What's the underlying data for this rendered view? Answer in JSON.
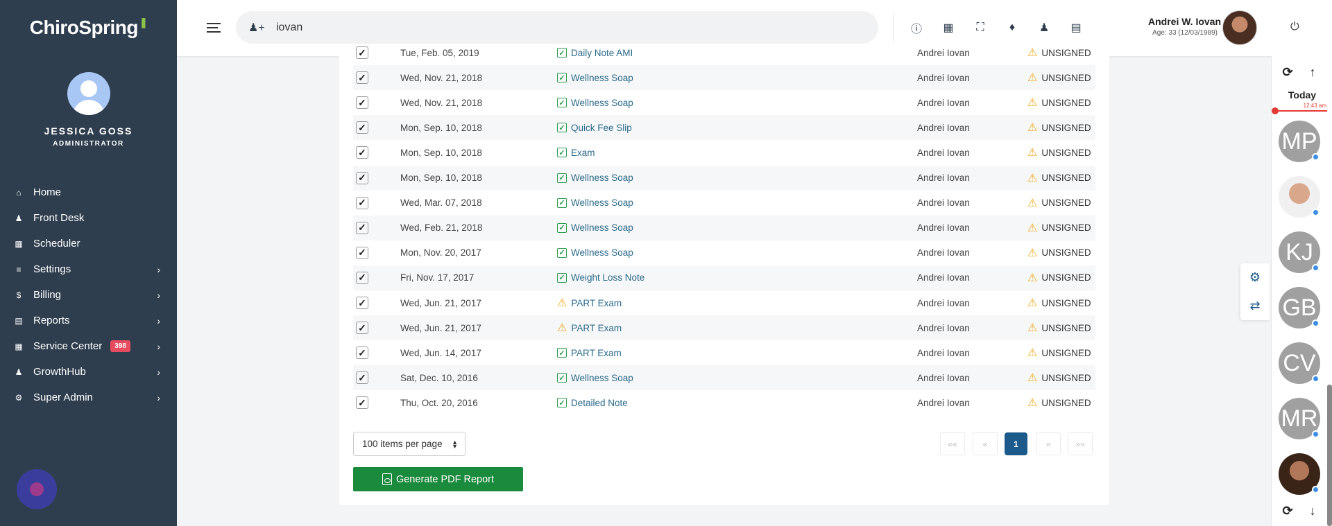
{
  "app": {
    "logo_text": "ChiroSpring",
    "user_name": "JESSICA GOSS",
    "user_role": "ADMINISTRATOR"
  },
  "sidebar": {
    "items": [
      {
        "label": "Home",
        "icon": "home-icon"
      },
      {
        "label": "Front Desk",
        "icon": "user-check-icon"
      },
      {
        "label": "Scheduler",
        "icon": "calendar-icon"
      },
      {
        "label": "Settings",
        "icon": "sliders-icon",
        "has_submenu": true
      },
      {
        "label": "Billing",
        "icon": "dollar-icon",
        "has_submenu": true
      },
      {
        "label": "Reports",
        "icon": "document-icon",
        "has_submenu": true
      },
      {
        "label": "Service Center",
        "icon": "grid-icon",
        "badge": "398",
        "has_submenu": true
      },
      {
        "label": "GrowthHub",
        "icon": "users-icon",
        "has_submenu": true
      },
      {
        "label": "Super Admin",
        "icon": "gear-icon",
        "has_submenu": true
      }
    ]
  },
  "header": {
    "search_value": "iovan",
    "user_name": "Andrei W. Iovan",
    "user_age": "Age: 33 (12/03/1989)"
  },
  "table": {
    "rows": [
      {
        "date": "Tue, Feb. 05, 2019",
        "document": "Daily Note AMI",
        "doc_status": "check",
        "provider": "Andrei Iovan",
        "status": "UNSIGNED"
      },
      {
        "date": "Wed, Nov. 21, 2018",
        "document": "Wellness Soap",
        "doc_status": "check",
        "provider": "Andrei Iovan",
        "status": "UNSIGNED"
      },
      {
        "date": "Wed, Nov. 21, 2018",
        "document": "Wellness Soap",
        "doc_status": "check",
        "provider": "Andrei Iovan",
        "status": "UNSIGNED"
      },
      {
        "date": "Mon, Sep. 10, 2018",
        "document": "Quick Fee Slip",
        "doc_status": "check",
        "provider": "Andrei Iovan",
        "status": "UNSIGNED"
      },
      {
        "date": "Mon, Sep. 10, 2018",
        "document": "Exam",
        "doc_status": "check",
        "provider": "Andrei Iovan",
        "status": "UNSIGNED"
      },
      {
        "date": "Mon, Sep. 10, 2018",
        "document": "Wellness Soap",
        "doc_status": "check",
        "provider": "Andrei Iovan",
        "status": "UNSIGNED"
      },
      {
        "date": "Wed, Mar. 07, 2018",
        "document": "Wellness Soap",
        "doc_status": "check",
        "provider": "Andrei Iovan",
        "status": "UNSIGNED"
      },
      {
        "date": "Wed, Feb. 21, 2018",
        "document": "Wellness Soap",
        "doc_status": "check",
        "provider": "Andrei Iovan",
        "status": "UNSIGNED"
      },
      {
        "date": "Mon, Nov. 20, 2017",
        "document": "Wellness Soap",
        "doc_status": "check",
        "provider": "Andrei Iovan",
        "status": "UNSIGNED"
      },
      {
        "date": "Fri, Nov. 17, 2017",
        "document": "Weight Loss Note",
        "doc_status": "check",
        "provider": "Andrei Iovan",
        "status": "UNSIGNED"
      },
      {
        "date": "Wed, Jun. 21, 2017",
        "document": "PART Exam",
        "doc_status": "warning",
        "provider": "Andrei Iovan",
        "status": "UNSIGNED"
      },
      {
        "date": "Wed, Jun. 21, 2017",
        "document": "PART Exam",
        "doc_status": "warning",
        "provider": "Andrei Iovan",
        "status": "UNSIGNED"
      },
      {
        "date": "Wed, Jun. 14, 2017",
        "document": "PART Exam",
        "doc_status": "check",
        "provider": "Andrei Iovan",
        "status": "UNSIGNED"
      },
      {
        "date": "Sat, Dec. 10, 2016",
        "document": "Wellness Soap",
        "doc_status": "check",
        "provider": "Andrei Iovan",
        "status": "UNSIGNED"
      },
      {
        "date": "Thu, Oct. 20, 2016",
        "document": "Detailed Note",
        "doc_status": "check",
        "provider": "Andrei Iovan",
        "status": "UNSIGNED"
      }
    ]
  },
  "pagination": {
    "per_page": "100 items per page",
    "first": "««",
    "prev": "«",
    "current": "1",
    "next": "»",
    "last": "»»"
  },
  "actions": {
    "pdf_label": "Generate PDF Report"
  },
  "rail": {
    "today_label": "Today",
    "time": "12:43 am",
    "avatars": [
      "MP",
      "",
      "KJ",
      "GB",
      "CV",
      "MR",
      ""
    ]
  },
  "colors": {
    "sidebar_bg": "#2f3e4e",
    "pdf_button": "#1a8a3c",
    "active_page": "#1b5a8a",
    "badge": "#e84c5f",
    "warning": "#f0a91d"
  }
}
